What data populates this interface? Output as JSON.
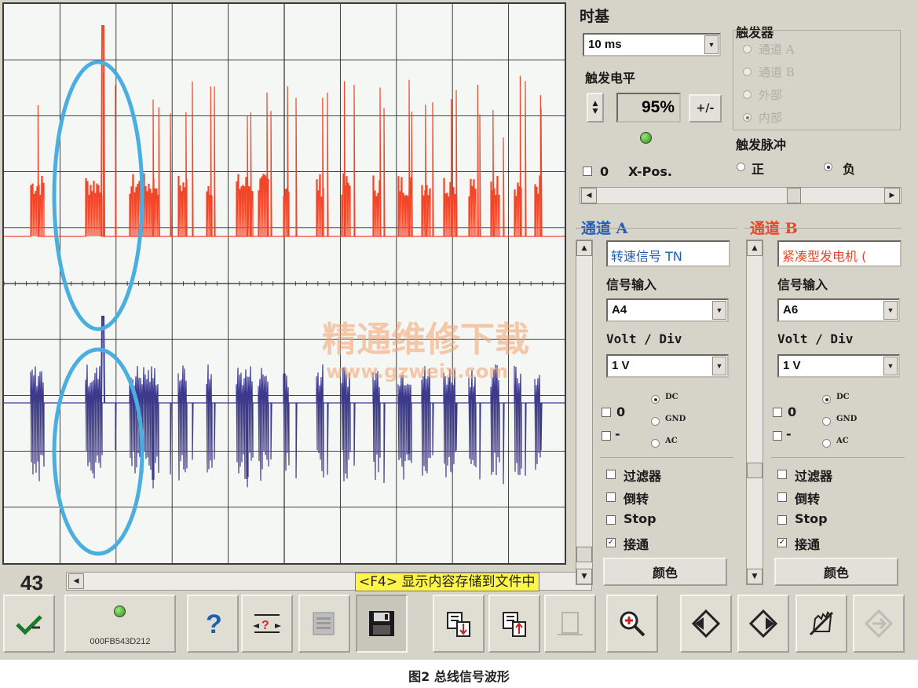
{
  "window": {
    "counter": "43",
    "status_message": "<F4> 显示内容存储到文件中"
  },
  "watermark": {
    "line1": "精通维修下载",
    "line2": "www.gzweix.com"
  },
  "timebase": {
    "title": "时基",
    "value": "10 ms",
    "trigger_level_label": "触发电平",
    "trigger_level_value": "95%",
    "sign_button": "+/-",
    "x_pos_check_label": "0",
    "x_pos_label": "X-Pos."
  },
  "trigger": {
    "title": "触发器",
    "sources": [
      "通道 A",
      "通道 B",
      "外部",
      "内部"
    ],
    "selected_source": "内部",
    "pulse_title": "触发脉冲",
    "pulse_pos": "正",
    "pulse_neg": "负",
    "selected_pulse": "负"
  },
  "channel_a": {
    "title": "通道 A",
    "color": "#1f5fb8",
    "name": "转速信号 TN",
    "input_label": "信号输入",
    "input_value": "A4",
    "volt_label": "Volt / Div",
    "volt_value": "1 V",
    "offset_label": "0",
    "invert_sign": "-",
    "coupling": [
      "DC",
      "GND",
      "AC"
    ],
    "selected_coupling": "DC",
    "options": [
      {
        "label": "过滤器",
        "checked": false
      },
      {
        "label": "倒转",
        "checked": false
      },
      {
        "label": "Stop",
        "checked": false
      },
      {
        "label": "接通",
        "checked": true
      }
    ],
    "color_button": "颜色"
  },
  "channel_b": {
    "title": "通道 B",
    "color": "#e8452a",
    "name": "紧凑型发电机 (",
    "input_label": "信号输入",
    "input_value": "A6",
    "volt_label": "Volt / Div",
    "volt_value": "1 V",
    "offset_label": "0",
    "invert_sign": "-",
    "coupling": [
      "DC",
      "GND",
      "AC"
    ],
    "selected_coupling": "DC",
    "options": [
      {
        "label": "过滤器",
        "checked": false
      },
      {
        "label": "倒转",
        "checked": false
      },
      {
        "label": "Stop",
        "checked": false
      },
      {
        "label": "接通",
        "checked": true
      }
    ],
    "color_button": "颜色"
  },
  "toolbar": {
    "device_id": "000FB543D212",
    "icons": [
      "confirm-check-icon",
      "device-status-icon",
      "help-icon",
      "measure-icon",
      "print-preview-icon",
      "save-disk-icon",
      "copy-down-icon",
      "copy-up-icon",
      "blank-page-icon",
      "zoom-icon",
      "nav-left-icon",
      "nav-right-icon",
      "hand-cancel-icon",
      "nav-next-icon"
    ]
  },
  "caption": "图2 总线信号波形",
  "colors": {
    "trace_top": "#f0462a",
    "trace_bottom": "#3d3a8c",
    "highlight_ellipse": "#4aaee0",
    "grid": "#2a2a2a"
  }
}
